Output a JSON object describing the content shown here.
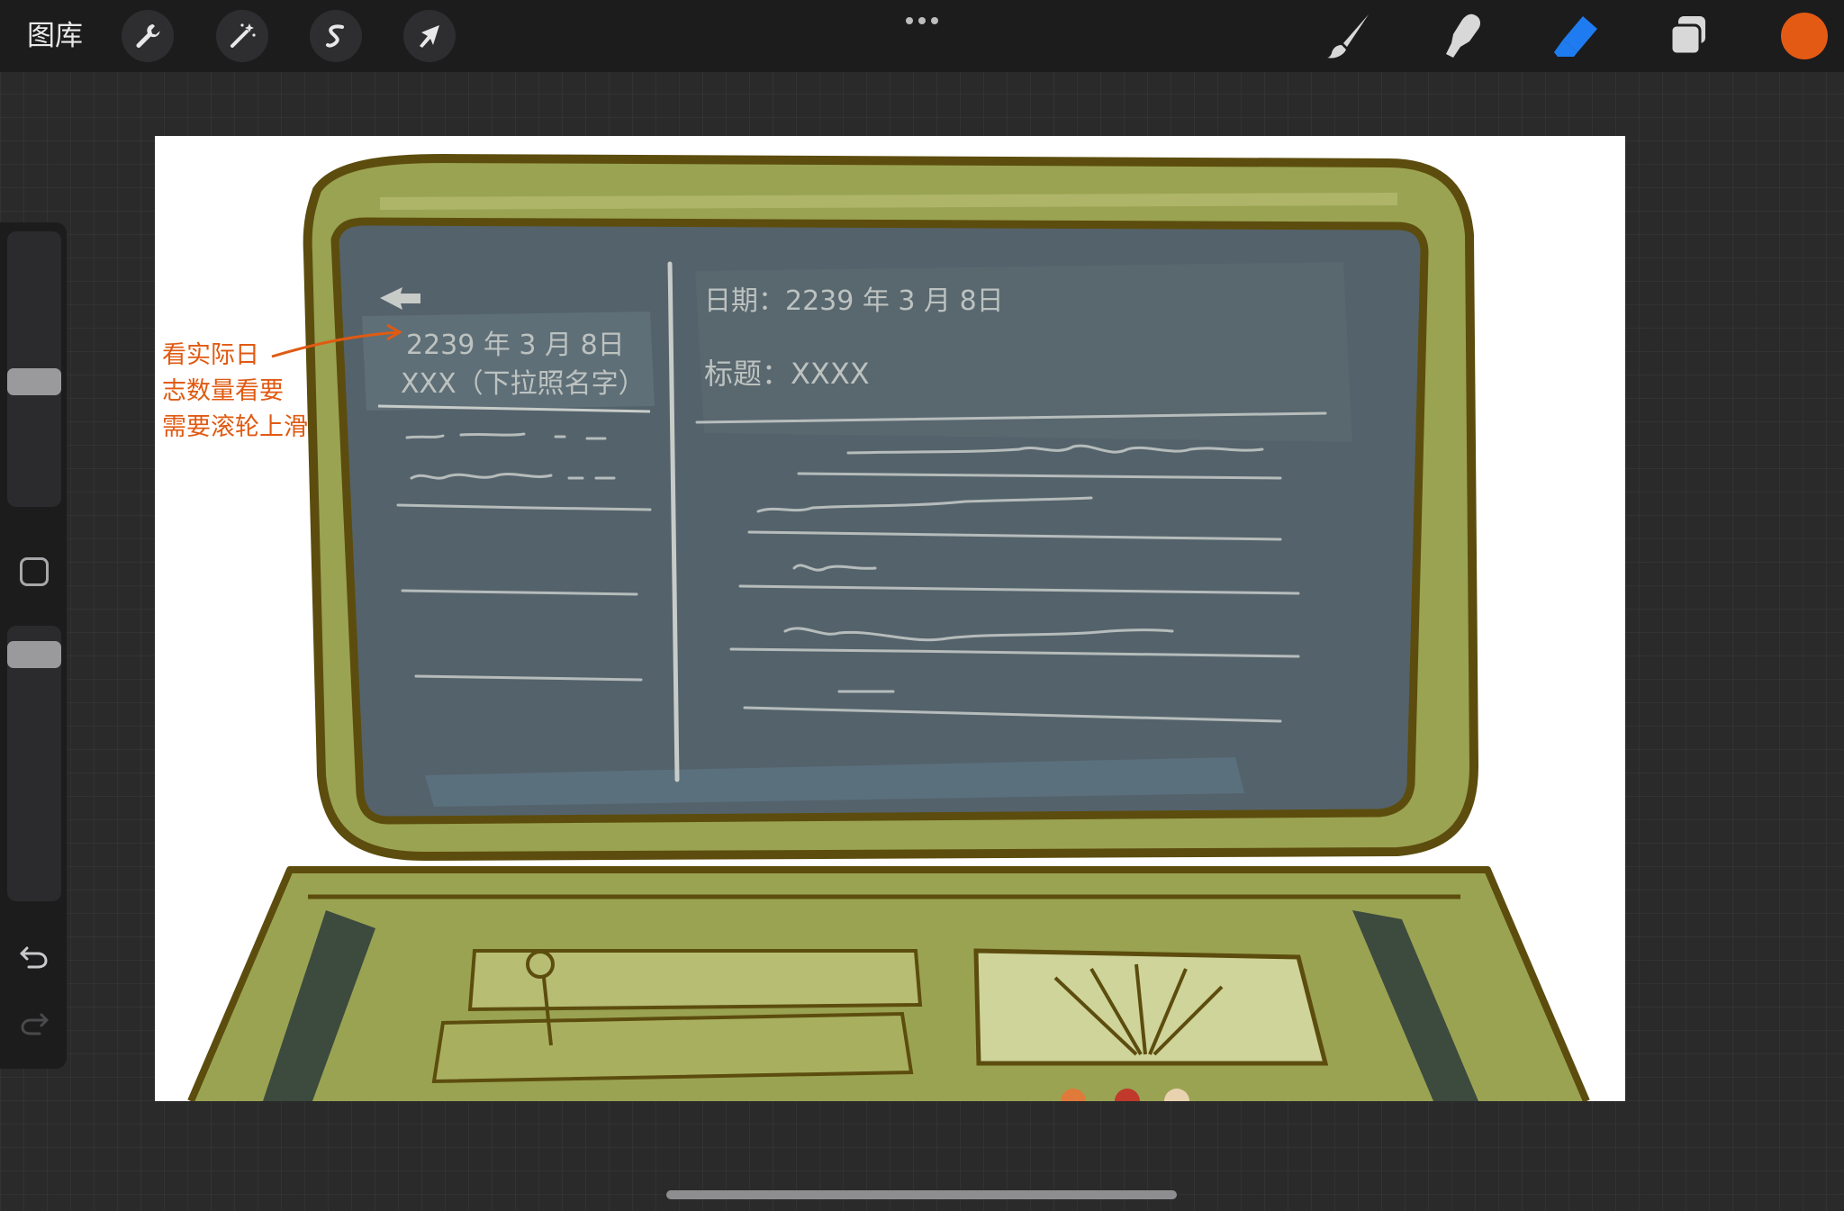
{
  "toolbar": {
    "gallery_label": "图库",
    "left_tools": [
      {
        "name": "actions",
        "icon": "wrench-icon"
      },
      {
        "name": "adjustments",
        "icon": "magic-wand-icon"
      },
      {
        "name": "selection",
        "icon": "selection-s-icon"
      },
      {
        "name": "transform",
        "icon": "arrow-cursor-icon"
      }
    ],
    "more_icon": "more-dots-icon",
    "right_tools": [
      {
        "name": "brush",
        "icon": "brush-icon",
        "active": false
      },
      {
        "name": "smudge",
        "icon": "smudge-finger-icon",
        "active": false
      },
      {
        "name": "eraser",
        "icon": "eraser-icon",
        "active": true
      },
      {
        "name": "layers",
        "icon": "layers-icon",
        "active": false
      }
    ],
    "current_color": "#e35a14",
    "active_tool_color": "#1f7cf0"
  },
  "sidebar": {
    "brush_size_level": 0.55,
    "opacity_level": 0.85,
    "modify_icon": "square-icon",
    "undo_icon": "undo-icon",
    "redo_icon": "redo-icon"
  },
  "canvas": {
    "background": "#ffffff",
    "sketch_texts": {
      "left_date": "2239 年 3 月 8日",
      "left_name": "XXX（下拉照名字）",
      "right_date": "日期：2239 年 3 月 8日",
      "right_title": "标题：XXXX",
      "annotation_line1": "看实际日",
      "annotation_line2": "志数量看要",
      "annotation_line3": "需要滚轮上滑"
    },
    "colors": {
      "olive_fill": "#9aa352",
      "olive_light": "#b7be74",
      "outline": "#5c4d0e",
      "screen": "#54626b",
      "screen_highlight": "#68787f",
      "chalk": "#c7ccc9",
      "annotation": "#e05a12"
    }
  }
}
